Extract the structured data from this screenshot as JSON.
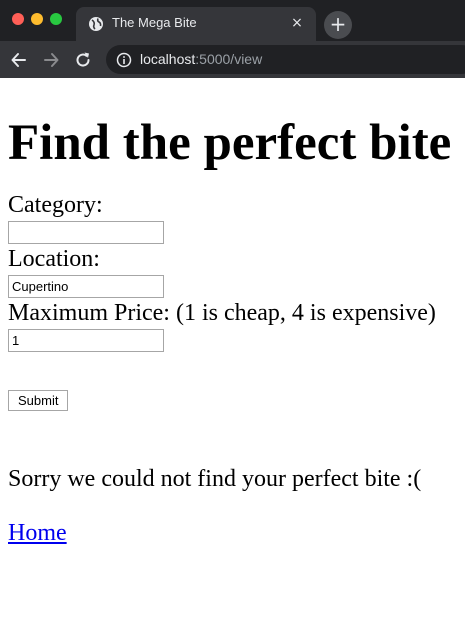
{
  "browser": {
    "tab_title": "The Mega Bite",
    "url_host": "localhost",
    "url_path": ":5000/view",
    "new_tab_label": "+",
    "close_label": "×"
  },
  "page": {
    "heading": "Find the perfect bite",
    "form": {
      "category_label": "Category:",
      "category_value": "",
      "location_label": "Location:",
      "location_value": "Cupertino",
      "price_label": "Maximum Price: (1 is cheap, 4 is expensive)",
      "price_value": "1",
      "submit_label": "Submit"
    },
    "message": "Sorry we could not find your perfect bite :(",
    "home_link": "Home"
  }
}
